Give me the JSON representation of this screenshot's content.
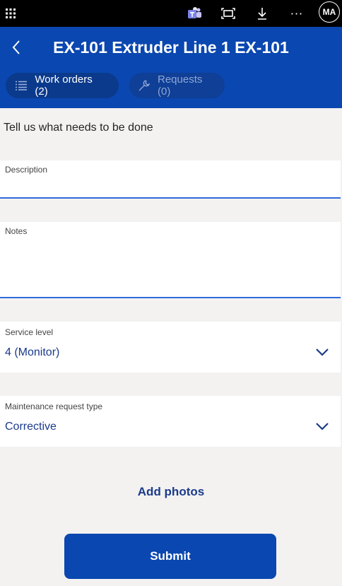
{
  "topbar": {
    "icons": [
      "app-grid-icon",
      "teams-icon",
      "fit-screen-icon",
      "download-icon",
      "more-icon"
    ],
    "more_glyph": "···",
    "avatar_initials": "MA"
  },
  "header": {
    "title": "EX-101 Extruder Line 1 EX-101",
    "tabs": [
      {
        "label": "Work orders (2)",
        "icon": "list-icon",
        "active": true
      },
      {
        "label": "Requests (0)",
        "icon": "wrench-icon",
        "active": false
      }
    ]
  },
  "form": {
    "intro": "Tell us what needs to be done",
    "description": {
      "label": "Description",
      "value": ""
    },
    "notes": {
      "label": "Notes",
      "value": ""
    },
    "service_level": {
      "label": "Service level",
      "value": "4 (Monitor)"
    },
    "request_type": {
      "label": "Maintenance request type",
      "value": "Corrective"
    },
    "add_photos": "Add photos",
    "submit": "Submit"
  },
  "colors": {
    "brand_blue": "#0a47b0",
    "accent_blue": "#1b3a8a",
    "background": "#f3f2f1"
  }
}
